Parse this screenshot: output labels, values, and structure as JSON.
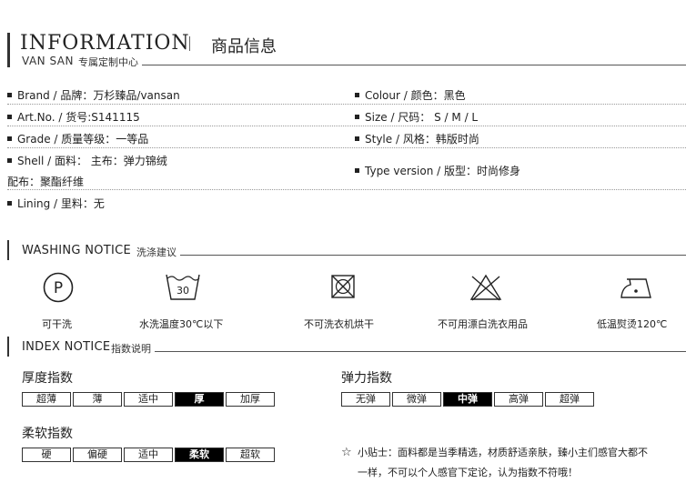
{
  "header": {
    "title_en": "INFORMATION",
    "title_cn": "商品信息",
    "brand_en": "VAN SAN",
    "brand_cn": "专属定制中心"
  },
  "info": {
    "left": [
      "Brand / 品牌：万杉臻品/vansan",
      "Art.No. / 货号:S141115",
      "Grade / 质量等级：一等品",
      "Shell / 面料： 主布：弹力锦绒",
      "配布：聚酯纤维",
      "Lining / 里料：无"
    ],
    "right": [
      "Colour / 颜色：黑色",
      "Size / 尺码： S / M / L",
      "Style / 风格：韩版时尚",
      "Type version / 版型：时尚修身"
    ]
  },
  "washing": {
    "title_en": "WASHING NOTICE",
    "title_cn": "洗涤建议",
    "tub_temp": "30",
    "items": [
      {
        "label": "可干洗",
        "icon": "dry-clean-p-icon"
      },
      {
        "label": "水洗温度30℃以下",
        "icon": "wash-30-icon"
      },
      {
        "label": "不可洗衣机烘干",
        "icon": "no-tumble-dry-icon"
      },
      {
        "label": "不可用漂白洗衣用品",
        "icon": "no-bleach-icon"
      },
      {
        "label": "低温熨烫120℃",
        "icon": "low-iron-icon"
      }
    ]
  },
  "index": {
    "title_en": "INDEX NOTICE",
    "title_cn": "指数说明",
    "thickness": {
      "label": "厚度指数",
      "options": [
        "超薄",
        "薄",
        "适中",
        "厚",
        "加厚"
      ],
      "selected": 3
    },
    "elasticity": {
      "label": "弹力指数",
      "options": [
        "无弹",
        "微弹",
        "中弹",
        "高弹",
        "超弹"
      ],
      "selected": 2
    },
    "softness": {
      "label": "柔软指数",
      "options": [
        "硬",
        "偏硬",
        "适中",
        "柔软",
        "超软"
      ],
      "selected": 3
    },
    "tip_star": "☆",
    "tip_line1": "小贴士：面料都是当季精选，材质舒适亲肤，臻小主们感官大都不",
    "tip_line2": "一样，不可以个人感官下定论，认为指数不符哦！"
  }
}
